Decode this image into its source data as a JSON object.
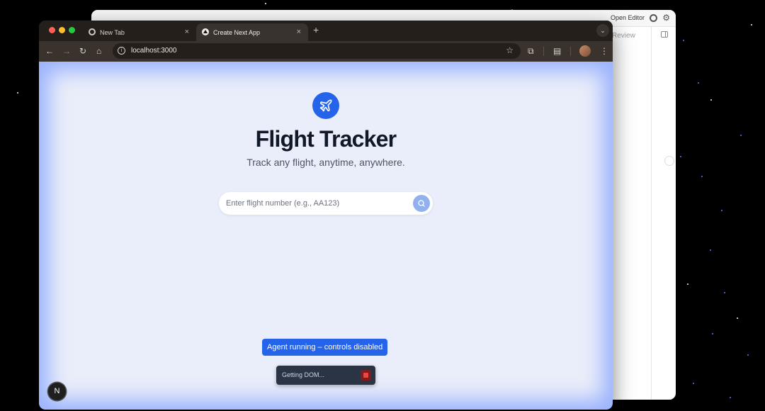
{
  "background_window": {
    "open_editor_label": "Open Editor",
    "review_label": "Review"
  },
  "browser": {
    "tabs": [
      {
        "title": "New Tab",
        "icon": "chrome-icon"
      },
      {
        "title": "Create Next App",
        "icon": "nextjs-triangle-icon",
        "active": true
      }
    ],
    "new_tab_symbol": "+",
    "tab_close_symbol": "×",
    "address": "localhost:3000"
  },
  "app": {
    "logo_icon": "airplane-icon",
    "title": "Flight Tracker",
    "subtitle": "Track any flight, anytime, anywhere.",
    "search": {
      "placeholder": "Enter flight number (e.g., AA123)",
      "value": "",
      "button_icon": "search-icon"
    }
  },
  "agent": {
    "banner": "Agent running – controls disabled",
    "status": "Getting DOM...",
    "stop_icon": "stop-icon"
  },
  "next_badge": "N",
  "colors": {
    "accent": "#2563eb",
    "title": "#111827",
    "glow": "#5a82ff"
  }
}
